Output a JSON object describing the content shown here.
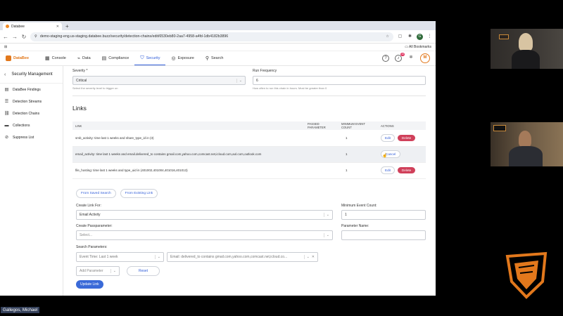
{
  "browser": {
    "tab_title": "Databee",
    "url": "demo-staging-eng.us-staging.databee.buzz/security/detection-chains/edit/6530eb80-2aa7-4958-a4fd-1db4182b3896",
    "bookmarks_label": "All Bookmarks",
    "profile_initial": "G"
  },
  "header": {
    "logo": "DataBee",
    "nav": [
      {
        "label": "Console",
        "icon": "console-icon"
      },
      {
        "label": "Data",
        "icon": "data-icon"
      },
      {
        "label": "Compliance",
        "icon": "compliance-icon"
      },
      {
        "label": "Security",
        "icon": "shield-icon"
      },
      {
        "label": "Exposure",
        "icon": "exposure-icon"
      },
      {
        "label": "Search",
        "icon": "search-icon"
      }
    ],
    "notification_count": "10",
    "avatar_initial": "M"
  },
  "sidebar": {
    "title": "Security Management",
    "items": [
      {
        "label": "DataBee Findings"
      },
      {
        "label": "Detection Streams"
      },
      {
        "label": "Detection Chains"
      },
      {
        "label": "Collections"
      },
      {
        "label": "Suppress List"
      }
    ]
  },
  "form": {
    "severity_label": "Severity *",
    "severity_value": "Critical",
    "severity_help": "Select the severity level to trigger on",
    "run_frequency_label": "Run Frequency",
    "run_frequency_value": "6",
    "run_frequency_help": "How often to run this chain in hours. Must be greater than 0"
  },
  "links": {
    "heading": "Links",
    "columns": [
      "LINK",
      "PASSED PARAMETER",
      "MINIMUM EVENT COUNT",
      "ACTIONS"
    ],
    "rows": [
      {
        "link": "smb_activity: time last 1 weeks and share_type_id in (3)",
        "passed": "",
        "min": "1",
        "actions": [
          "Edit",
          "Delete"
        ]
      },
      {
        "link": "email_activity: time last 1 weeks and email.delivered_to contains gmail.com,yahoo.com,comcast.net,icloud.com,aol.com,outlook.com",
        "passed": "",
        "min": "1",
        "actions": [
          "Cancel"
        ]
      },
      {
        "link": "file_hosting: time last 1 weeks and type_uid in (401002,401004,401016,401013)",
        "passed": "",
        "min": "1",
        "actions": [
          "Edit",
          "Delete"
        ]
      }
    ]
  },
  "link_editor": {
    "from_saved_search": "From Saved Search",
    "from_existing_link": "From Existing Link",
    "create_link_for_label": "Create Link For:",
    "create_link_for_value": "Email Activity",
    "min_event_count_label": "Minimum Event Count:",
    "min_event_count_value": "1",
    "create_passparameter_label": "Create Passparameter:",
    "create_passparameter_placeholder": "Select...",
    "parameter_name_label": "Parameter Name:",
    "parameter_name_value": "",
    "search_parameters_label": "Search Parameters:",
    "param_time": "Event Time: Last 1 week",
    "param_email": "Email: delivered_to contains gmail.com,yahoo.com,comcast.net,icloud.co...",
    "add_parameter_placeholder": "Add Parameter",
    "reset_label": "Reset",
    "update_label": "Update Link"
  },
  "meeting": {
    "participant_name": "Gallegos, Michael"
  }
}
